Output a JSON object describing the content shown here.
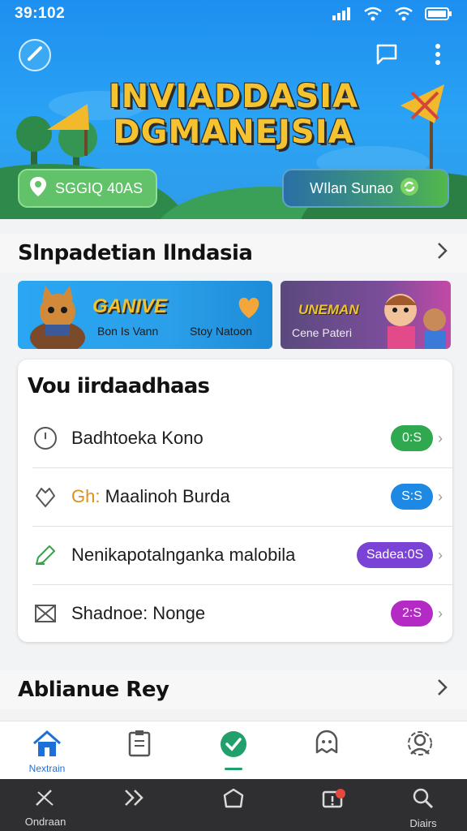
{
  "status_bar": {
    "time": "39:102"
  },
  "hero": {
    "title_line1": "INVIADDASIA",
    "title_line2": "DGMANEJSIA",
    "pill_left_label": "SGGIQ 40AS",
    "pill_right_label": "WIlan Sunao",
    "colors": {
      "sky": "#1d8ff0",
      "title": "#f6c330",
      "pill_green": "#62c26a"
    }
  },
  "section1": {
    "title": "Slnpadetian llndasia"
  },
  "banners": {
    "a": {
      "title": "GANIVE",
      "sub1": "Bon Is Vann",
      "sub2": "Stoy Natoon"
    },
    "b": {
      "title": "UNEMAN",
      "sub": "Cene Pateri"
    }
  },
  "card": {
    "title": "Vou iirdaadhaas",
    "rows": [
      {
        "icon": "clock-icon",
        "label": "Badhtoeka Kono",
        "badge": "0:S",
        "badge_color": "#2fa84f"
      },
      {
        "icon": "heart-diamond-icon",
        "label_accent": "Gh:",
        "label": " Maalinoh Burda",
        "badge": "S:S",
        "badge_color": "#1e88e5"
      },
      {
        "icon": "pen-icon",
        "label": "Nenikapotalnganka malobila",
        "badge": "Sadea:0S",
        "badge_color": "#7b42d6"
      },
      {
        "icon": "envelope-icon",
        "label": "Shadnoe: Nonge",
        "badge": "2:S",
        "badge_color": "#b42ac4"
      }
    ]
  },
  "section2": {
    "title": "Ablianue Rey"
  },
  "bottom_nav": {
    "items": [
      {
        "icon": "home-icon",
        "label": "Nextrain"
      },
      {
        "icon": "clipboard-icon",
        "label": ""
      },
      {
        "icon": "check-circle-icon",
        "label": ""
      },
      {
        "icon": "ghost-icon",
        "label": ""
      },
      {
        "icon": "gear-person-icon",
        "label": ""
      }
    ]
  },
  "system_bar": {
    "items": [
      {
        "icon": "no-wand-icon",
        "label": "Ondraan"
      },
      {
        "icon": "forward-icon",
        "label": ""
      },
      {
        "icon": "circle-icon",
        "label": ""
      },
      {
        "icon": "alert-icon",
        "label": ""
      },
      {
        "icon": "search-icon",
        "label": "Diairs"
      }
    ]
  }
}
